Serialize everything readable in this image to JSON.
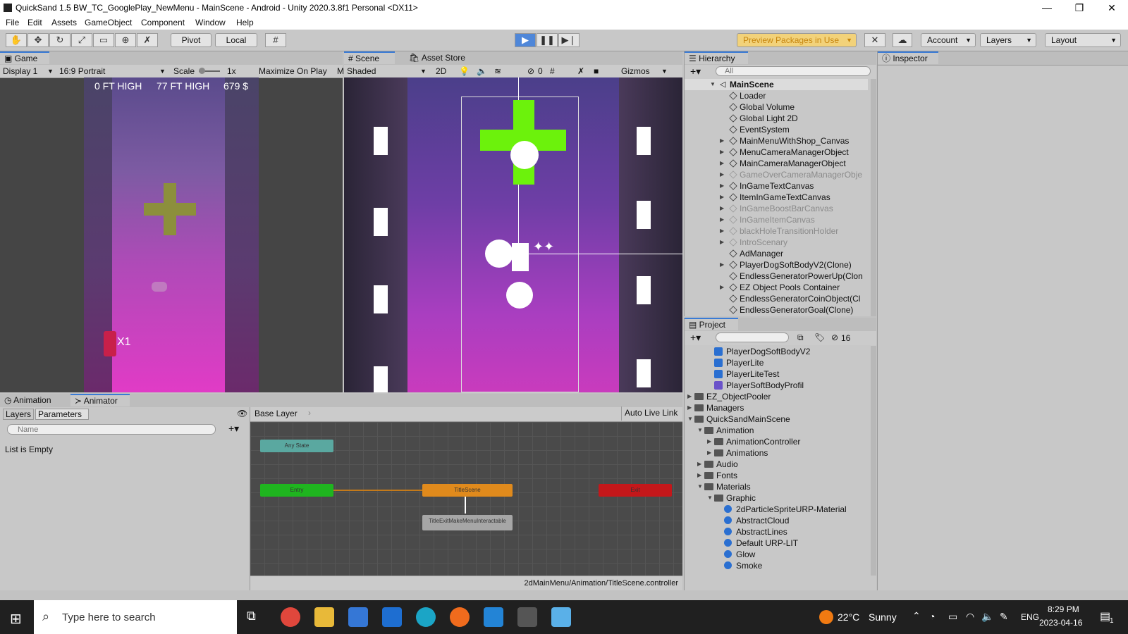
{
  "window": {
    "title": "QuickSand 1.5 BW_TC_GooglePlay_NewMenu - MainScene - Android - Unity 2020.3.8f1 Personal <DX11>",
    "minimize": "—",
    "restore": "❐",
    "close": "✕"
  },
  "menu": [
    "File",
    "Edit",
    "Assets",
    "GameObject",
    "Component",
    "Window",
    "Help"
  ],
  "toolbar": {
    "pivot": "Pivot",
    "local": "Local",
    "preview_packages": "Preview Packages in Use",
    "account": "Account",
    "layers": "Layers",
    "layout": "Layout",
    "accent": "#4f87d9"
  },
  "game": {
    "tab": "Game",
    "display": "Display 1",
    "aspect": "16:9 Portrait",
    "scale_label": "Scale",
    "scale_value": "1x",
    "maximize": "Maximize On Play",
    "more": "M",
    "hud_ft": "0 FT HIGH",
    "hud_best": "77 FT HIGH",
    "hud_money": "679 $",
    "multiplier": "X1"
  },
  "scene": {
    "tab_scene": "Scene",
    "tab_store": "Asset Store",
    "shading": "Shaded",
    "mode2d": "2D",
    "hidden_count": "0",
    "gizmos": "Gizmos"
  },
  "hierarchy": {
    "tab": "Hierarchy",
    "search_placeholder": "All",
    "root": "MainScene",
    "items": [
      {
        "label": "Loader",
        "expandable": false,
        "dim": false
      },
      {
        "label": "Global Volume",
        "expandable": false,
        "dim": false
      },
      {
        "label": "Global Light 2D",
        "expandable": false,
        "dim": false
      },
      {
        "label": "EventSystem",
        "expandable": false,
        "dim": false
      },
      {
        "label": "MainMenuWithShop_Canvas",
        "expandable": true,
        "dim": false
      },
      {
        "label": "MenuCameraManagerObject",
        "expandable": true,
        "dim": false
      },
      {
        "label": "MainCameraManagerObject",
        "expandable": true,
        "dim": false
      },
      {
        "label": "GameOverCameraManagerObje",
        "expandable": true,
        "dim": true
      },
      {
        "label": "InGameTextCanvas",
        "expandable": true,
        "dim": false
      },
      {
        "label": "ItemInGameTextCanvas",
        "expandable": true,
        "dim": false
      },
      {
        "label": "InGameBoostBarCanvas",
        "expandable": true,
        "dim": true
      },
      {
        "label": "InGameItemCanvas",
        "expandable": true,
        "dim": true
      },
      {
        "label": "blackHoleTransitionHolder",
        "expandable": true,
        "dim": true
      },
      {
        "label": "IntroScenary",
        "expandable": true,
        "dim": true
      },
      {
        "label": "AdManager",
        "expandable": false,
        "dim": false
      },
      {
        "label": "PlayerDogSoftBodyV2(Clone)",
        "expandable": true,
        "dim": false
      },
      {
        "label": "EndlessGeneratorPowerUp(Clon",
        "expandable": false,
        "dim": false
      },
      {
        "label": "EZ Object Pools Container",
        "expandable": true,
        "dim": false
      },
      {
        "label": "EndlessGeneratorCoinObject(Cl",
        "expandable": false,
        "dim": false
      },
      {
        "label": "EndlessGeneratorGoal(Clone)",
        "expandable": false,
        "dim": false
      }
    ]
  },
  "inspector": {
    "tab": "Inspector"
  },
  "project": {
    "tab": "Project",
    "hidden_count": "16",
    "items": [
      {
        "label": "PlayerDogSoftBodyV2",
        "icon": "prefab-icon",
        "indent": 3,
        "arrow": ""
      },
      {
        "label": "PlayerLite",
        "icon": "prefab-icon",
        "indent": 3,
        "arrow": ""
      },
      {
        "label": "PlayerLiteTest",
        "icon": "prefab-icon",
        "indent": 3,
        "arrow": ""
      },
      {
        "label": "PlayerSoftBodyProfil",
        "icon": "profile-icon",
        "indent": 3,
        "arrow": ""
      },
      {
        "label": "EZ_ObjectPooler",
        "icon": "folder-icon",
        "indent": 1,
        "arrow": "▶"
      },
      {
        "label": "Managers",
        "icon": "folder-icon",
        "indent": 1,
        "arrow": "▶"
      },
      {
        "label": "QuickSandMainScene",
        "icon": "folder-icon",
        "indent": 1,
        "arrow": "▼"
      },
      {
        "label": "Animation",
        "icon": "folder-icon",
        "indent": 2,
        "arrow": "▼"
      },
      {
        "label": "AnimationController",
        "icon": "folder-icon",
        "indent": 3,
        "arrow": "▶"
      },
      {
        "label": "Animations",
        "icon": "folder-icon",
        "indent": 3,
        "arrow": "▶"
      },
      {
        "label": "Audio",
        "icon": "folder-icon",
        "indent": 2,
        "arrow": "▶"
      },
      {
        "label": "Fonts",
        "icon": "folder-icon",
        "indent": 2,
        "arrow": "▶"
      },
      {
        "label": "Materials",
        "icon": "folder-icon",
        "indent": 2,
        "arrow": "▼"
      },
      {
        "label": "Graphic",
        "icon": "folder-icon",
        "indent": 3,
        "arrow": "▼"
      },
      {
        "label": "2dParticleSpriteURP-Material",
        "icon": "material-icon",
        "indent": 4,
        "arrow": ""
      },
      {
        "label": "AbstractCloud",
        "icon": "material-icon",
        "indent": 4,
        "arrow": ""
      },
      {
        "label": "AbstractLines",
        "icon": "material-icon",
        "indent": 4,
        "arrow": ""
      },
      {
        "label": "Default URP-LIT",
        "icon": "material-icon",
        "indent": 4,
        "arrow": ""
      },
      {
        "label": "Glow",
        "icon": "material-icon",
        "indent": 4,
        "arrow": ""
      },
      {
        "label": "Smoke",
        "icon": "material-icon",
        "indent": 4,
        "arrow": ""
      }
    ]
  },
  "animator": {
    "tab_animation": "Animation",
    "tab_animator": "Animator",
    "tab_layers": "Layers",
    "tab_parameters": "Parameters",
    "search_placeholder": "Name",
    "empty": "List is Empty",
    "base_layer": "Base Layer",
    "auto_live": "Auto Live Link",
    "states": {
      "any": "Any State",
      "entry": "Entry",
      "title": "TitleScene",
      "exit": "Exit",
      "title_exit": "TitleExitMakeMenuInteractable"
    },
    "path": "2dMainMenu/Animation/TitleScene.controller"
  },
  "taskbar": {
    "search": "Type here to search",
    "temperature": "22°C",
    "weather": "Sunny",
    "lang": "ENG",
    "time": "8:29 PM",
    "date": "2023-04-16",
    "notif_count": "1"
  }
}
